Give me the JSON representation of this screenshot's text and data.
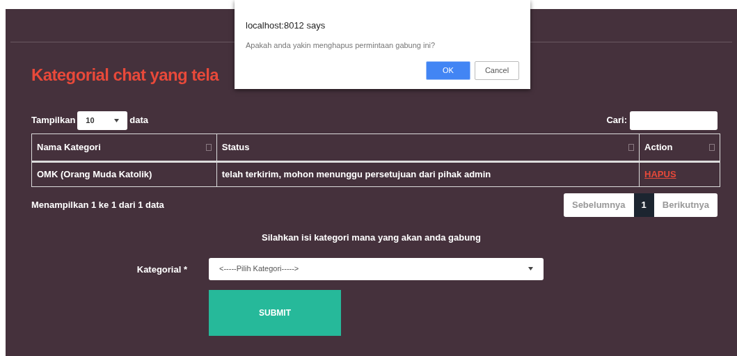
{
  "heading": "Kategorial chat yang tela",
  "length_menu": {
    "label_before": "Tampilkan",
    "value": "10",
    "label_after": "data"
  },
  "search": {
    "label": "Cari:"
  },
  "table": {
    "columns": [
      "Nama Kategori",
      "Status",
      "Action"
    ],
    "rows": [
      {
        "name": "OMK (Orang Muda Katolik)",
        "status": "telah terkirim, mohon menunggu persetujuan dari pihak admin",
        "action": "HAPUS"
      }
    ]
  },
  "info": "Menampilkan 1 ke 1 dari 1 data",
  "pagination": {
    "previous": "Sebelumnya",
    "pages": [
      {
        "label": "1",
        "selected": true
      }
    ],
    "next": "Berikutnya"
  },
  "form": {
    "intro": "Silahkan isi kategori mana yang akan anda gabung",
    "label": "Kategorial *",
    "select_value": "<-----Pilih Kategori----->",
    "submit": "SUBMIT"
  },
  "dialog": {
    "title": "localhost:8012 says",
    "message": "Apakah anda yakin menghapus permintaan gabung ini?",
    "ok": "OK",
    "cancel": "Cancel"
  }
}
